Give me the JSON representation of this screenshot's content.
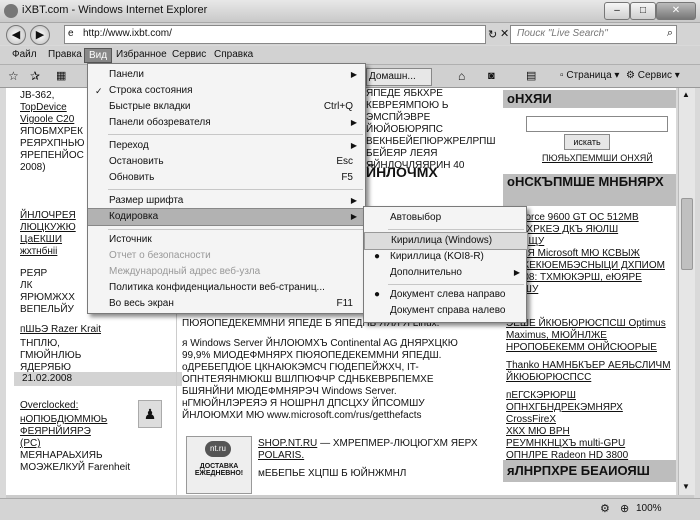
{
  "window": {
    "title": "iXBT.com - Windows Internet Explorer",
    "min": "–",
    "max": "□",
    "close": "✕"
  },
  "address": {
    "url": "http://www.ixbt.com/",
    "search_placeholder": "Поиск \"Live Search\""
  },
  "menubar": [
    "Файл",
    "Правка",
    "Вид",
    "Избранное",
    "Сервис",
    "Справка"
  ],
  "toolbar": {
    "tab": "Домашн...",
    "page": "Страница",
    "tools": "Сервис"
  },
  "vid_menu": {
    "items": [
      {
        "label": "Панели",
        "arrow": "▶"
      },
      {
        "label": "Строка состояния",
        "check": "✓"
      },
      {
        "label": "Быстрые вкладки",
        "shortcut": "Ctrl+Q"
      },
      {
        "label": "Панели обозревателя",
        "arrow": "▶"
      },
      {
        "label": "Переход",
        "arrow": "▶"
      },
      {
        "label": "Остановить",
        "shortcut": "Esc"
      },
      {
        "label": "Обновить",
        "shortcut": "F5"
      },
      {
        "label": "Размер шрифта",
        "arrow": "▶"
      },
      {
        "label": "Кодировка",
        "arrow": "▶"
      },
      {
        "label": "Источник"
      },
      {
        "label": "Отчет о безопасности"
      },
      {
        "label": "Международный адрес веб-узла"
      },
      {
        "label": "Политика конфиденциальности веб-страниц..."
      },
      {
        "label": "Во весь экран",
        "shortcut": "F11"
      }
    ]
  },
  "encoding_submenu": {
    "items": [
      {
        "label": "Автовыбор"
      },
      {
        "label": "Кириллица (Windows)"
      },
      {
        "label": "Кириллица (KOI8-R)",
        "dot": "●"
      },
      {
        "label": "Дополнительно",
        "arrow": "▶"
      },
      {
        "label": "Документ слева направо",
        "dot": "●"
      },
      {
        "label": "Документ справа налево"
      }
    ]
  },
  "page": {
    "left_lines": [
      "JB-362,",
      "TopDevice",
      "Vigoole C20",
      "ЯПОБМХРЕК",
      "РЕЯРХПНЬЮ",
      "ЯРЕПЕНЙОС",
      "2008)"
    ],
    "left_lines2": [
      "ЙНЛОЧРЕЯ",
      "ЛЮЦКУЖЮ",
      "ЦаЕКШИ",
      "жхтнбніі"
    ],
    "left_lines3": [
      "РЕЯР",
      "ЛК",
      "ЯРЮМЖХХ",
      "ВЕПЕЛЬЙУ"
    ],
    "left_link": "пШЬЭ Razer Krait",
    "left_lines4": [
      "ТНПЛЮ,",
      "ГМЮЙНЛЮЬ",
      "ЯДЕРЯБЮ"
    ],
    "date": "21.02.2008",
    "overclocked": "Overclocked:",
    "left_lines5": [
      "нОПЮБДЮММЮЬ",
      "ФЕЯРНЙИЯРЭ",
      "(PC)",
      "МЕЯНАРАЬХИЯЬ",
      "МОЭЖЕЛКУЙ Farenheit"
    ],
    "mid_lines_top": [
      "ЯПЕДЕ ЯБКХРЕ КЕВРЕЯМПОЮ Ь",
      "ЭМСПЙЭВРЕ ЙЮЙОБЮРЯПС",
      "ВЕКНБЕЙЕПЮРЖРЕЛРПШ",
      "БЕЙЕЯР ЛЕЯЯ ЯЙНЛОЧЛЯЯРИН 40"
    ],
    "mid_heading": "ЙНЛОЧМХ",
    "mid_lines": [
      "ПЮЯОПЕДЕКЕММНИ ЯПЕДЕ Б ЯПЕДНБ ЯЯЛ Я Linux.",
      "я Windows Server ЙНЛОЮМХЪ Continental AG ДНЯРХЦКЮ",
      "99,9% МИОДЕФМНЯРХ ПЮЯОПЕДЕКЕММНИ ЯПЕДШ.",
      "оДРЕБЕПДЮЕ ЦКНАЮКЭМСЧ ГЮДЕПЕЙЖХЧ, IT-",
      "ОПНТЕЯЯНМЮКШ ВШЛПЮФЧР СДНБКЕВРБПЕМХЕ",
      "БШЯНЙНИ МЮДЕФМНЯРЭЧ Windows Server.",
      "нГМЮЙНЛЭРЕЯЭ Я НОШРНЛ ДПСЦХУ ЙПСОМШУ",
      "ЙНЛОЮМХИ МЮ www.microsoft.com/rus/getthefacts"
    ],
    "shop_link": "SHOP.NT.RU",
    "shop_text": "— ХМРЕПМЕР-ЛЮЦЮГХМ ЯЕРХ",
    "polaris": "POLARIS.",
    "shop_more": "мЕБЕПЬЕ ХЦПШ Б ЮЙНЖМНЛ",
    "shop_badge": "nt.ru",
    "shop_badge2": "ДОСТАВКА ЕЖЕДНЕВНО!",
    "right_head1": "оНХЯИ",
    "right_btn": "искать",
    "right_link1": "ПЮЯЬХПЕММШИ ОНХЯЙ",
    "right_head2": "оНСКЪПМШЕ МНБНЯРХ",
    "right_lines": [
      "GeForce 9600 GT OC 512MB",
      "ЛПЕХРКЕЭ ДКЪ ЯЮЛШ",
      "ЕШЕЩУ",
      "ЯСИЯ Microsoft МЮ КСВЫЖ",
      "НЕЖЕКЮЕМБЭСНЫЦИ ДХПИОМ",
      "ЮЯ08: ТХМЮКЭРШ, еЮЯРЕ",
      "ЮЕШУ"
    ],
    "right_lines2": [
      "ЭЕШЕ ЙКЮБЮРЮСПСШ Optimus",
      "Maximus,       МЮЙНЛЖЕ",
      "НРОПОБЕКЕММ ОНЙСЮОРЫЕ"
    ],
    "thanko": "Thanko НАМНБКЪЕР АЕЯЬСЛИЧМ",
    "thanko2": "ЙКЮБЮРЮСПСС",
    "right_lines3": [
      "пЕГСКЭРЮРШ",
      "ОПНХГБНДРЕКЭМНЯРХ CrossFireX",
      "ХКХ     МЮ     ВРН",
      "РЕУМНКНЦХЪ multi-GPU",
      "ОПНЛРЕ Radeon HD 3800"
    ],
    "right_head3": "яЛНРПХРЕ БЕАИОЯШ"
  },
  "status": {
    "zoom": "100%"
  }
}
